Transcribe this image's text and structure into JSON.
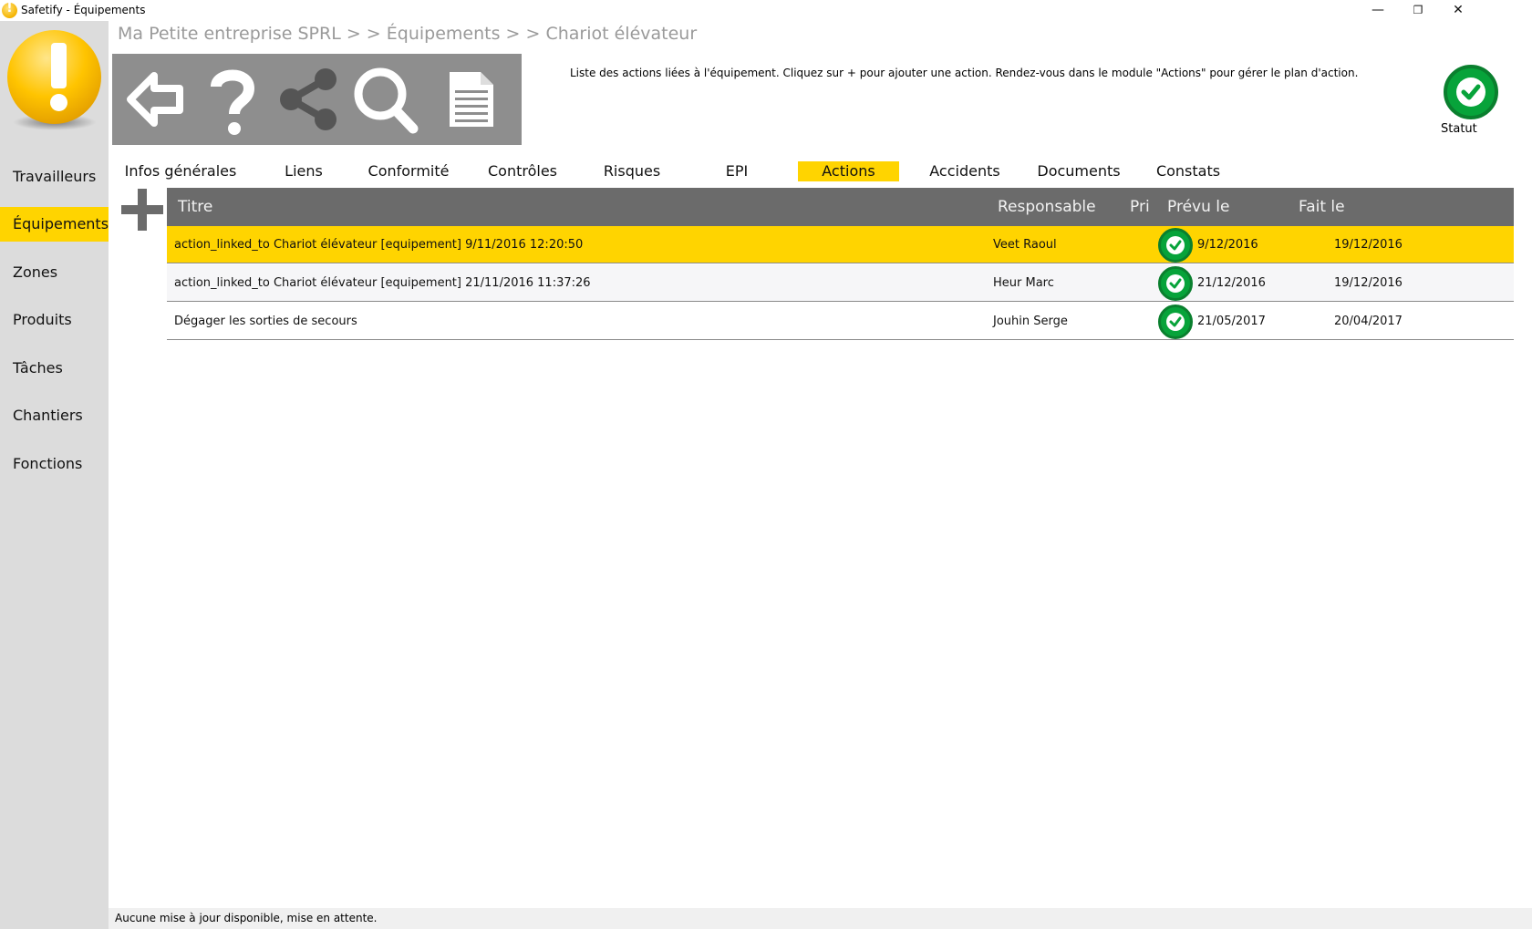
{
  "window": {
    "title": "Safetify - Équipements",
    "minimize": "—",
    "restore": "❐",
    "close": "✕"
  },
  "sidebar": {
    "items": [
      {
        "label": "Travailleurs"
      },
      {
        "label": "Équipements",
        "active": true
      },
      {
        "label": "Zones"
      },
      {
        "label": "Produits"
      },
      {
        "label": "Tâches"
      },
      {
        "label": "Chantiers"
      },
      {
        "label": "Fonctions"
      }
    ]
  },
  "breadcrumb": "Ma Petite entreprise SPRL  > >  Équipements  > >  Chariot élévateur",
  "toolbar": {
    "icons": [
      "back-arrow-icon",
      "help-icon",
      "share-icon",
      "search-icon",
      "document-icon"
    ]
  },
  "help_text": "Liste des actions liées à l'équipement. Cliquez sur + pour ajouter une action. Rendez-vous dans le module \"Actions\" pour gérer le plan d'action.",
  "status": {
    "label": "Statut",
    "color": "#07a33a"
  },
  "tabs": [
    {
      "label": "Infos générales"
    },
    {
      "label": "Liens"
    },
    {
      "label": "Conformité"
    },
    {
      "label": "Contrôles"
    },
    {
      "label": "Risques"
    },
    {
      "label": "EPI"
    },
    {
      "label": "Actions",
      "active": true
    },
    {
      "label": "Accidents"
    },
    {
      "label": "Documents"
    },
    {
      "label": "Constats"
    }
  ],
  "table": {
    "headers": {
      "titre": "Titre",
      "responsable": "Responsable",
      "pri": "Pri",
      "prevu": "Prévu le",
      "fait": "Fait le"
    },
    "rows": [
      {
        "titre": "action_linked_to Chariot élévateur [equipement]  9/11/2016 12:20:50",
        "responsable": "Veet Raoul",
        "prevu": "9/12/2016",
        "fait": "19/12/2016",
        "selected": true
      },
      {
        "titre": "action_linked_to Chariot élévateur [equipement]  21/11/2016 11:37:26",
        "responsable": "Heur Marc",
        "prevu": "21/12/2016",
        "fait": "19/12/2016"
      },
      {
        "titre": "Dégager les sorties de secours",
        "responsable": "Jouhin Serge",
        "prevu": "21/05/2017",
        "fait": "20/04/2017"
      }
    ]
  },
  "statusbar": "Aucune mise à jour disponible, mise en attente.",
  "colors": {
    "accent": "#ffd400",
    "toolbar": "#8e8e8e",
    "header": "#6b6b6b",
    "ok": "#07a33a"
  }
}
